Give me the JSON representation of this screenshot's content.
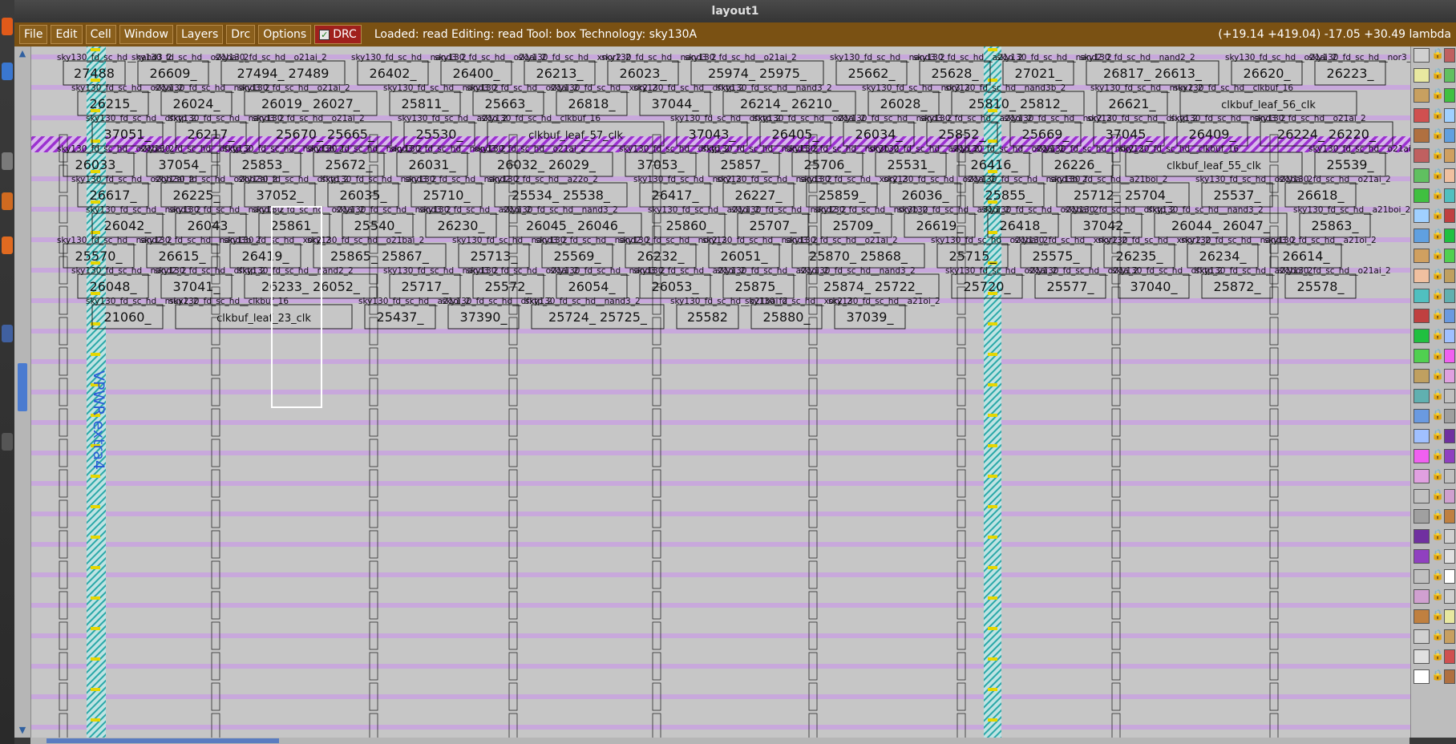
{
  "window": {
    "title": "layout1"
  },
  "menubar": {
    "menus": [
      "File",
      "Edit",
      "Cell",
      "Window",
      "Layers",
      "Drc",
      "Options"
    ],
    "drc_label": "DRC",
    "status": "Loaded: read Editing: read Tool: box  Technology: sky130A",
    "coords": "(+19.14 +419.04) -17.05 +30.49 lambda"
  },
  "icons": {
    "launcher": [
      "ubuntu-dash-icon",
      "firefox-icon",
      "files-icon",
      "office-icon",
      "software-icon",
      "terminal-icon",
      "workspace-icon"
    ],
    "scroll_up": "arrow-up-icon",
    "scroll_down": "arrow-down-icon",
    "check": "checkmark-icon",
    "lock": "lock-icon"
  },
  "colors": {
    "menubar": "#7a5113",
    "drc": "#a0201c",
    "canvas": "#c6c6c6",
    "metal_stripe": "#c8a8dc",
    "hatch": "#9b30d0",
    "power_rail": "#2aa8a8"
  },
  "layout": {
    "power_label": "VPWR extra4",
    "cells": [
      {
        "t": "sky130_fd_sc_hd__nand3_2",
        "n": "27488"
      },
      {
        "t": "sky130_fd_sc_hd__o21bai_2",
        "n": "26609_"
      },
      {
        "t": "sky130_fd_sc_hd__o21ai_2",
        "n": "27494_ 27489"
      },
      {
        "t": "sky130_fd_sc_hd__nand3_2",
        "n": "26402_"
      },
      {
        "t": "sky130_fd_sc_hd__o21ai_2",
        "n": "26400_"
      },
      {
        "t": "sky130_fd_sc_hd__xnor2_2",
        "n": "26213_"
      },
      {
        "t": "sky130_fd_sc_hd__nand3_2",
        "n": "26023_"
      },
      {
        "t": "sky130_fd_sc_hd__o21ai_2",
        "n": "25974_ 25975_"
      },
      {
        "t": "sky130_fd_sc_hd__nand3_2",
        "n": "25662_"
      },
      {
        "t": "sky130_fd_sc_hd__a21o_2",
        "n": "25628_"
      },
      {
        "t": "sky130_fd_sc_hd__nand2_2",
        "n": "27021_"
      },
      {
        "t": "sky130_fd_sc_hd__nand2_2",
        "n": "26817_ 26613_"
      },
      {
        "t": "sky130_fd_sc_hd__o21ai_2",
        "n": "26620_"
      },
      {
        "t": "sky130_fd_sc_hd__nor3_2",
        "n": "26223_"
      },
      {
        "t": "sky130_fd_sc_hd__o21ai_2",
        "n": "26215_"
      },
      {
        "t": "sky130_fd_sc_hd__nand3_2",
        "n": "26024_"
      },
      {
        "t": "sky130_fd_sc_hd__o21ai_2",
        "n": "26019_ 26027_"
      },
      {
        "t": "sky130_fd_sc_hd__nand3_2",
        "n": "25811_"
      },
      {
        "t": "sky130_fd_sc_hd__o21ai_2",
        "n": "25663_"
      },
      {
        "t": "sky130_fd_sc_hd__xor2_2",
        "n": "26818_"
      },
      {
        "t": "sky130_fd_sc_hd__dfxtp_2",
        "n": "37044_"
      },
      {
        "t": "sky130_fd_sc_hd__nand3_2",
        "n": "26214_ 26210_"
      },
      {
        "t": "sky130_fd_sc_hd__nor3_2",
        "n": "26028_"
      },
      {
        "t": "sky130_fd_sc_hd__nand3b_2",
        "n": "25810_ 25812_"
      },
      {
        "t": "sky130_fd_sc_hd__mux2_2",
        "n": "26621_"
      },
      {
        "t": "sky130_fd_sc_hd__clkbuf_16",
        "n": "clkbuf_leaf_56_clk"
      },
      {
        "t": "sky130_fd_sc_hd__dfxtp_2",
        "n": "37051_"
      },
      {
        "t": "sky130_fd_sc_hd__nand3_2",
        "n": "26217_"
      },
      {
        "t": "sky130_fd_sc_hd__o21ai_2",
        "n": "25670_ 25665_"
      },
      {
        "t": "sky130_fd_sc_hd__a21o_2",
        "n": "25530_"
      },
      {
        "t": "sky130_fd_sc_hd__clkbuf_16",
        "n": "clkbuf_leaf_57_clk"
      },
      {
        "t": "sky130_fd_sc_hd__dfxtp_2",
        "n": "37043_"
      },
      {
        "t": "sky130_fd_sc_hd__o21ai_2",
        "n": "26405_"
      },
      {
        "t": "sky130_fd_sc_hd__nand3_2",
        "n": "26034_"
      },
      {
        "t": "sky130_fd_sc_hd__a21oi_2",
        "n": "25852_"
      },
      {
        "t": "sky130_fd_sc_hd__nor2_2",
        "n": "25669_"
      },
      {
        "t": "sky130_fd_sc_hd__dfxtp_2",
        "n": "37045_"
      },
      {
        "t": "sky130_fd_sc_hd__nand3_2",
        "n": "26409_"
      },
      {
        "t": "sky130_fd_sc_hd__o21ai_2",
        "n": "26224_ 26220_"
      },
      {
        "t": "sky130_fd_sc_hd__o21bai_2",
        "n": "26033_"
      },
      {
        "t": "sky130_fd_sc_hd__dfxtp_2",
        "n": "37054_"
      },
      {
        "t": "sky130_fd_sc_hd__nand3b_2",
        "n": "25853_"
      },
      {
        "t": "sky130_fd_sc_hd__nand3_2",
        "n": "25672_"
      },
      {
        "t": "sky130_fd_sc_hd__nand3_2",
        "n": "26031_"
      },
      {
        "t": "sky130_fd_sc_hd__o21ai_2",
        "n": "26032_ 26029_"
      },
      {
        "t": "sky130_fd_sc_hd__dfxtp_2",
        "n": "37053_"
      },
      {
        "t": "sky130_fd_sc_hd__nand3_2",
        "n": "25857_"
      },
      {
        "t": "sky130_fd_sc_hd__nor3b_2",
        "n": "25706_"
      },
      {
        "t": "sky130_fd_sc_hd__a21o_2",
        "n": "25531_"
      },
      {
        "t": "sky130_fd_sc_hd__o21ai_2",
        "n": "26416_"
      },
      {
        "t": "sky130_fd_sc_hd__nor2_2",
        "n": "26226_"
      },
      {
        "t": "sky130_fd_sc_hd__clkbuf_16",
        "n": "clkbuf_leaf_55_clk"
      },
      {
        "t": "sky130_fd_sc_hd__o21ai_2",
        "n": "25539_"
      },
      {
        "t": "sky130_fd_sc_hd__o2bb2ai_2",
        "n": "26617_"
      },
      {
        "t": "sky130_fd_sc_hd__o2bb2ai_2",
        "n": "26225_"
      },
      {
        "t": "sky130_fd_sc_hd__dfxtp_2",
        "n": "37052_"
      },
      {
        "t": "sky130_fd_sc_hd__nand3_2",
        "n": "26035_"
      },
      {
        "t": "sky130_fd_sc_hd__nand2_2",
        "n": "25710_"
      },
      {
        "t": "sky130_fd_sc_hd__a22o_2",
        "n": "25534_ 25538_"
      },
      {
        "t": "sky130_fd_sc_hd__nor2_2",
        "n": "26417_"
      },
      {
        "t": "sky130_fd_sc_hd__nand3_2",
        "n": "26227_"
      },
      {
        "t": "sky130_fd_sc_hd__xor2_2",
        "n": "25859_"
      },
      {
        "t": "sky130_fd_sc_hd__o21ai_2",
        "n": "26036_"
      },
      {
        "t": "sky130_fd_sc_hd__nand3b_2",
        "n": "25855_"
      },
      {
        "t": "sky130_fd_sc_hd__a21boi_2",
        "n": "25712_ 25704_"
      },
      {
        "t": "sky130_fd_sc_hd__o21bai_2",
        "n": "25537_"
      },
      {
        "t": "sky130_fd_sc_hd__o21ai_2",
        "n": "26618_"
      },
      {
        "t": "sky130_fd_sc_hd__nand3_2",
        "n": "26042_"
      },
      {
        "t": "sky130_fd_sc_hd__nand3_2",
        "n": "26043_"
      },
      {
        "t": "sky130_fd_sc_hd__o21ai_2",
        "n": "25861_"
      },
      {
        "t": "sky130_fd_sc_hd__nand3_2",
        "n": "25540_"
      },
      {
        "t": "sky130_fd_sc_hd__a21oi_2",
        "n": "26230_"
      },
      {
        "t": "sky130_fd_sc_hd__nand3_2",
        "n": "26045_ 26046_"
      },
      {
        "t": "sky130_fd_sc_hd__a21oi_2",
        "n": "25860_"
      },
      {
        "t": "sky130_fd_sc_hd__nand2_2",
        "n": "25707_"
      },
      {
        "t": "sky130_fd_sc_hd__nor3b_2",
        "n": "25709_"
      },
      {
        "t": "sky130_fd_sc_hd__a31oi_2",
        "n": "26619_"
      },
      {
        "t": "sky130_fd_sc_hd__o21bai_2",
        "n": "26418_"
      },
      {
        "t": "sky130_fd_sc_hd__dfxtp_2",
        "n": "37042_"
      },
      {
        "t": "sky130_fd_sc_hd__nand3_2",
        "n": "26044_ 26047_"
      },
      {
        "t": "sky130_fd_sc_hd__a21boi_2",
        "n": "25863_"
      },
      {
        "t": "sky130_fd_sc_hd__nand2_2",
        "n": "25570_"
      },
      {
        "t": "sky130_fd_sc_hd__nand3b_2",
        "n": "26615_"
      },
      {
        "t": "sky130_fd_sc_hd__xor2_2",
        "n": "26419_"
      },
      {
        "t": "sky130_fd_sc_hd__o21bai_2",
        "n": "25865_ 25867_"
      },
      {
        "t": "sky130_fd_sc_hd__nand3_2",
        "n": "25713_"
      },
      {
        "t": "sky130_fd_sc_hd__nand2_2",
        "n": "25569_"
      },
      {
        "t": "sky130_fd_sc_hd__nor2_2",
        "n": "26232_"
      },
      {
        "t": "sky130_fd_sc_hd__nand3_2",
        "n": "26051_"
      },
      {
        "t": "sky130_fd_sc_hd__o21ai_2",
        "n": "25870_ 25868_"
      },
      {
        "t": "sky130_fd_sc_hd__o21bai_2",
        "n": "25715_"
      },
      {
        "t": "sky130_fd_sc_hd__xnor2_2",
        "n": "25575_"
      },
      {
        "t": "sky130_fd_sc_hd__xnor2_2",
        "n": "26235_"
      },
      {
        "t": "sky130_fd_sc_hd__nand3_2",
        "n": "26234_"
      },
      {
        "t": "sky130_fd_sc_hd__a21oi_2",
        "n": "26614_"
      },
      {
        "t": "sky130_fd_sc_hd__nand2_2",
        "n": "26048_"
      },
      {
        "t": "sky130_fd_sc_hd__dfxtp_2",
        "n": "37041_"
      },
      {
        "t": "sky130_fd_sc_hd__nand2_2",
        "n": "26233_ 26052_"
      },
      {
        "t": "sky130_fd_sc_hd__nand3_2",
        "n": "25717_"
      },
      {
        "t": "sky130_fd_sc_hd__o21ai_2",
        "n": "25572_"
      },
      {
        "t": "sky130_fd_sc_hd__nand3_2",
        "n": "26054_"
      },
      {
        "t": "sky130_fd_sc_hd__a21oi_2",
        "n": "26053_"
      },
      {
        "t": "sky130_fd_sc_hd__a21oi_2",
        "n": "25875_"
      },
      {
        "t": "sky130_fd_sc_hd__nand3_2",
        "n": "25874_ 25722_"
      },
      {
        "t": "sky130_fd_sc_hd__o21ai_2",
        "n": "25720_"
      },
      {
        "t": "sky130_fd_sc_hd__o21a_2",
        "n": "25577_"
      },
      {
        "t": "sky130_fd_sc_hd__dfxtp_2",
        "n": "37040_"
      },
      {
        "t": "sky130_fd_sc_hd__a21boi_2",
        "n": "25872_"
      },
      {
        "t": "sky130_fd_sc_hd__o21ai_2",
        "n": "25578_"
      },
      {
        "t": "sky130_fd_sc_hd__mux2_2",
        "n": "21060_"
      },
      {
        "t": "sky130_fd_sc_hd__clkbuf_16",
        "n": "clkbuf_leaf_23_clk"
      },
      {
        "t": "sky130_fd_sc_hd__a21oi_2",
        "n": "25437_"
      },
      {
        "t": "sky130_fd_sc_hd__dfxtp_2",
        "n": "37390_"
      },
      {
        "t": "sky130_fd_sc_hd__nand3_2",
        "n": "25724_ 25725_"
      },
      {
        "t": "sky130_fd_sc_hd__o21bai_2",
        "n": "25582"
      },
      {
        "t": "sky130_fd_sc_hd__xor2_2",
        "n": "25880_"
      },
      {
        "t": "sky130_fd_sc_hd__a21oi_2",
        "n": "37039_"
      }
    ]
  }
}
